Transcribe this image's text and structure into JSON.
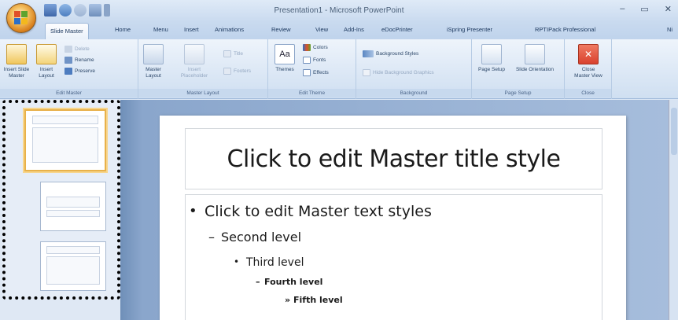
{
  "app": {
    "window_title": "Presentation1 - Microsoft PowerPoint",
    "window_buttons": [
      "–",
      "▭",
      "✕"
    ]
  },
  "tabs": [
    "Slide Master",
    "Home",
    "Menu",
    "Insert",
    "Animations",
    "Review",
    "View",
    "Add-Ins",
    "eDocPrinter",
    "iSpring Presenter",
    "RPTIPack Professional",
    "Ni"
  ],
  "ribbon": {
    "edit_master": {
      "label": "Edit Master",
      "insert_slide_master": "Insert Slide Master",
      "insert_layout": "Insert Layout",
      "delete": "Delete",
      "rename": "Rename",
      "preserve": "Preserve"
    },
    "master_layout": {
      "label": "Master Layout",
      "master_layout_btn": "Master Layout",
      "insert_placeholder": "Insert Placeholder",
      "title": "Title",
      "footers": "Footers"
    },
    "edit_theme": {
      "label": "Edit Theme",
      "themes": "Themes",
      "colors": "Colors",
      "fonts": "Fonts",
      "effects": "Effects"
    },
    "background": {
      "label": "Background",
      "background_styles": "Background Styles",
      "hide_background_graphics": "Hide Background Graphics"
    },
    "page_setup": {
      "label": "Page Setup",
      "page_setup_btn": "Page Setup",
      "slide_orientation": "Slide Orientation"
    },
    "close": {
      "label": "Close",
      "close_master_view": "Close Master View"
    }
  },
  "slide_pane": {
    "selected_number": "1"
  },
  "slide": {
    "title": "Click to edit Master title style",
    "levels": [
      "Click to edit Master text styles",
      "Second level",
      "Third level",
      "Fourth level",
      "Fifth level"
    ],
    "bullets": [
      "•",
      "–",
      "•",
      "–",
      "»"
    ]
  },
  "colors": {
    "office_orange": "#d87f1c",
    "selection_orange": "#f0a24a",
    "ribbon_blue": "#dbe7f5",
    "close_red": "#d9412e"
  }
}
